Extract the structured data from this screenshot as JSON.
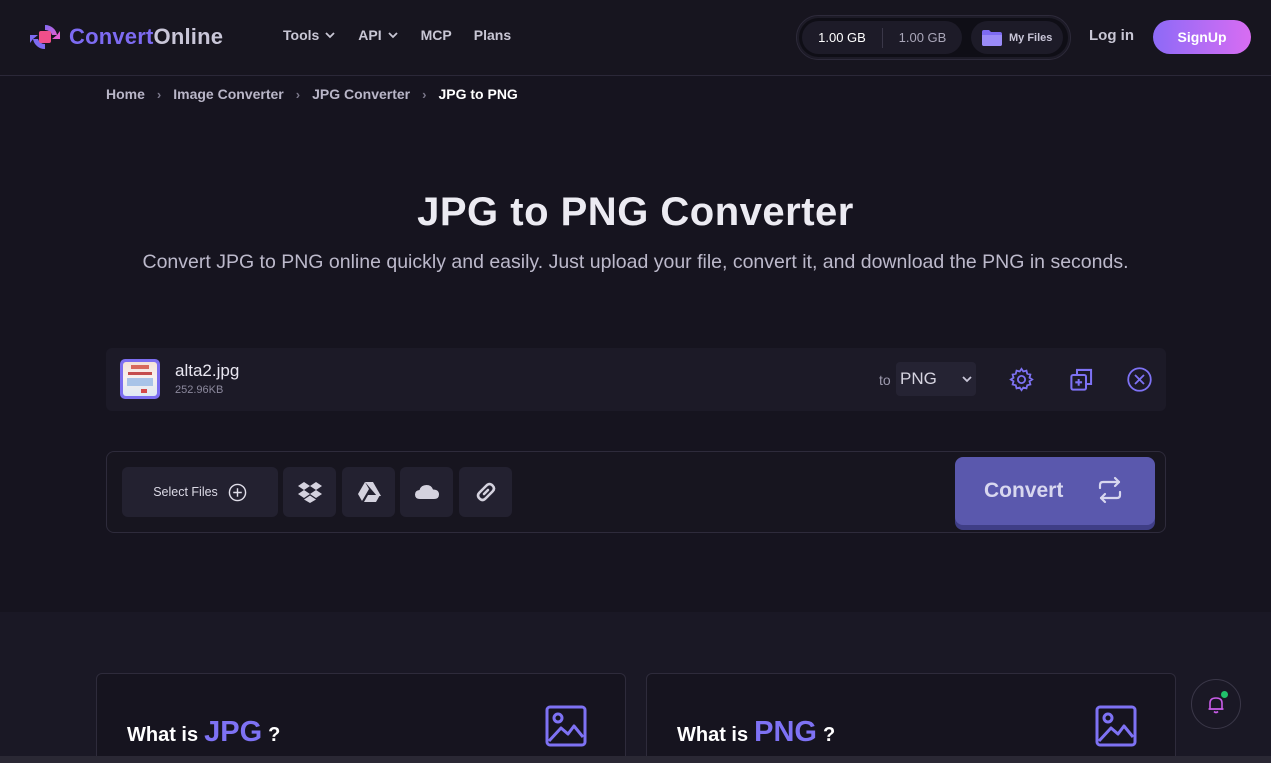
{
  "brand": {
    "name_part1": "Convert",
    "name_part2": "Online"
  },
  "nav": {
    "items": [
      {
        "label": "Tools",
        "has_dropdown": true
      },
      {
        "label": "API",
        "has_dropdown": true
      },
      {
        "label": "MCP",
        "has_dropdown": false
      },
      {
        "label": "Plans",
        "has_dropdown": false
      }
    ]
  },
  "storage": {
    "used": "1.00 GB",
    "total": "1.00 GB",
    "my_files_label": "My Files"
  },
  "auth": {
    "login_label": "Log in",
    "signup_label": "SignUp"
  },
  "breadcrumb": [
    {
      "label": "Home"
    },
    {
      "label": "Image Converter"
    },
    {
      "label": "JPG Converter"
    },
    {
      "label": "JPG to PNG"
    }
  ],
  "hero": {
    "title": "JPG to PNG Converter",
    "subtitle": "Convert JPG to PNG online quickly and easily. Just upload your file, convert it, and download the PNG in seconds."
  },
  "file": {
    "name": "alta2.jpg",
    "size": "252.96KB",
    "to_label": "to",
    "target_format": "PNG"
  },
  "upload": {
    "select_files_label": "Select Files",
    "sources": [
      "dropbox-icon",
      "google-drive-icon",
      "onedrive-icon",
      "url-link-icon"
    ],
    "convert_label": "Convert"
  },
  "info_cards": [
    {
      "prefix": "What is",
      "format": "JPG",
      "suffix": "?"
    },
    {
      "prefix": "What is",
      "format": "PNG",
      "suffix": "?"
    }
  ],
  "colors": {
    "background": "#16141f",
    "accent": "#7e72f4",
    "convert_button": "#5a58ad",
    "signup_gradient_start": "#8d6af7",
    "signup_gradient_end": "#d86df2",
    "notification_dot": "#21c06b"
  }
}
